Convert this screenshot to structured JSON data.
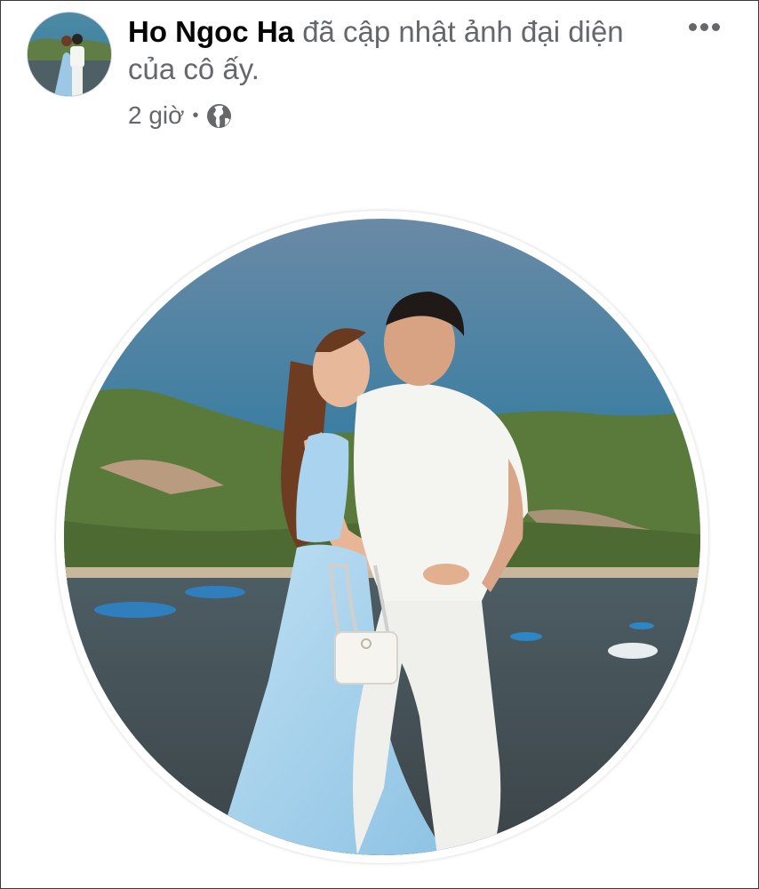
{
  "post": {
    "author_name": "Ho Ngoc Ha",
    "action_text": "đã cập nhật ảnh đại diện của cô ấy.",
    "time": "2 giờ",
    "separator": "•",
    "audience_icon": "globe-icon",
    "more_icon": "more-horizontal-icon"
  },
  "colors": {
    "name_text": "#050505",
    "secondary_text": "#65676b",
    "background": "#ffffff"
  }
}
